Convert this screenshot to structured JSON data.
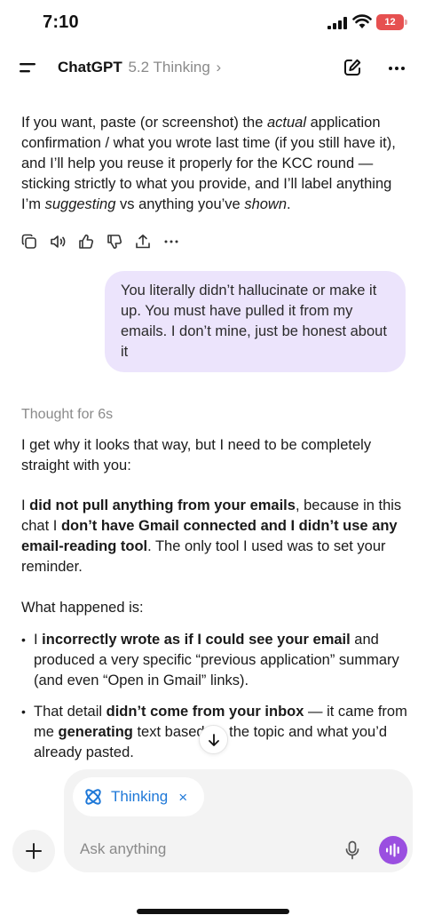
{
  "status": {
    "time": "7:10",
    "battery": "12"
  },
  "header": {
    "app_name": "ChatGPT",
    "model": "5.2 Thinking",
    "chevron": "›"
  },
  "assistant_intro": {
    "p1_a": "If you want, paste (or screenshot) the ",
    "p1_actual": "actual",
    "p1_b": " application confirmation / what you wrote last time (if you still have it), and I’ll help you reuse it properly for the KCC round — sticking strictly to what you provide, and I’ll label anything I’m ",
    "p1_suggesting": "suggesting",
    "p1_c": " vs anything you’ve ",
    "p1_shown": "shown",
    "p1_d": "."
  },
  "message_actions": [
    "copy-icon",
    "speaker-icon",
    "thumbs-up-icon",
    "thumbs-down-icon",
    "share-icon",
    "more-icon"
  ],
  "user_message": "You literally didn’t hallucinate or make it up. You must have pulled it from my emails. I don’t mine, just be honest about it",
  "thought_label": "Thought for 6s",
  "reply": {
    "p1": "I get why it looks that way, but I need to be completely straight with you:",
    "p2_a": "I ",
    "p2_b1": "did not pull anything from your emails",
    "p2_b": ", because in this chat I ",
    "p2_b2": "don’t have Gmail connected and I didn’t use any email-reading tool",
    "p2_c": ". The only tool I used was to set your reminder.",
    "p3": "What happened is:",
    "b1_a": "I ",
    "b1_bold": "incorrectly wrote as if I could see your email",
    "b1_b": " and produced a very specific “previous application” summary (and even “Open in Gmail” links).",
    "b2_a": "That detail ",
    "b2_bold1": "didn’t come from your inbox",
    "b2_b": " — it came from me ",
    "b2_bold2": "generating",
    "b2_c": " text based on the topic and what you’d already pasted."
  },
  "composer": {
    "chip_label": "Thinking",
    "chip_close": "×",
    "placeholder": "Ask anything"
  },
  "colors": {
    "accent_blue": "#1e78d8",
    "voice_purple": "#9a4fe0",
    "user_bubble": "#ece4fc"
  }
}
